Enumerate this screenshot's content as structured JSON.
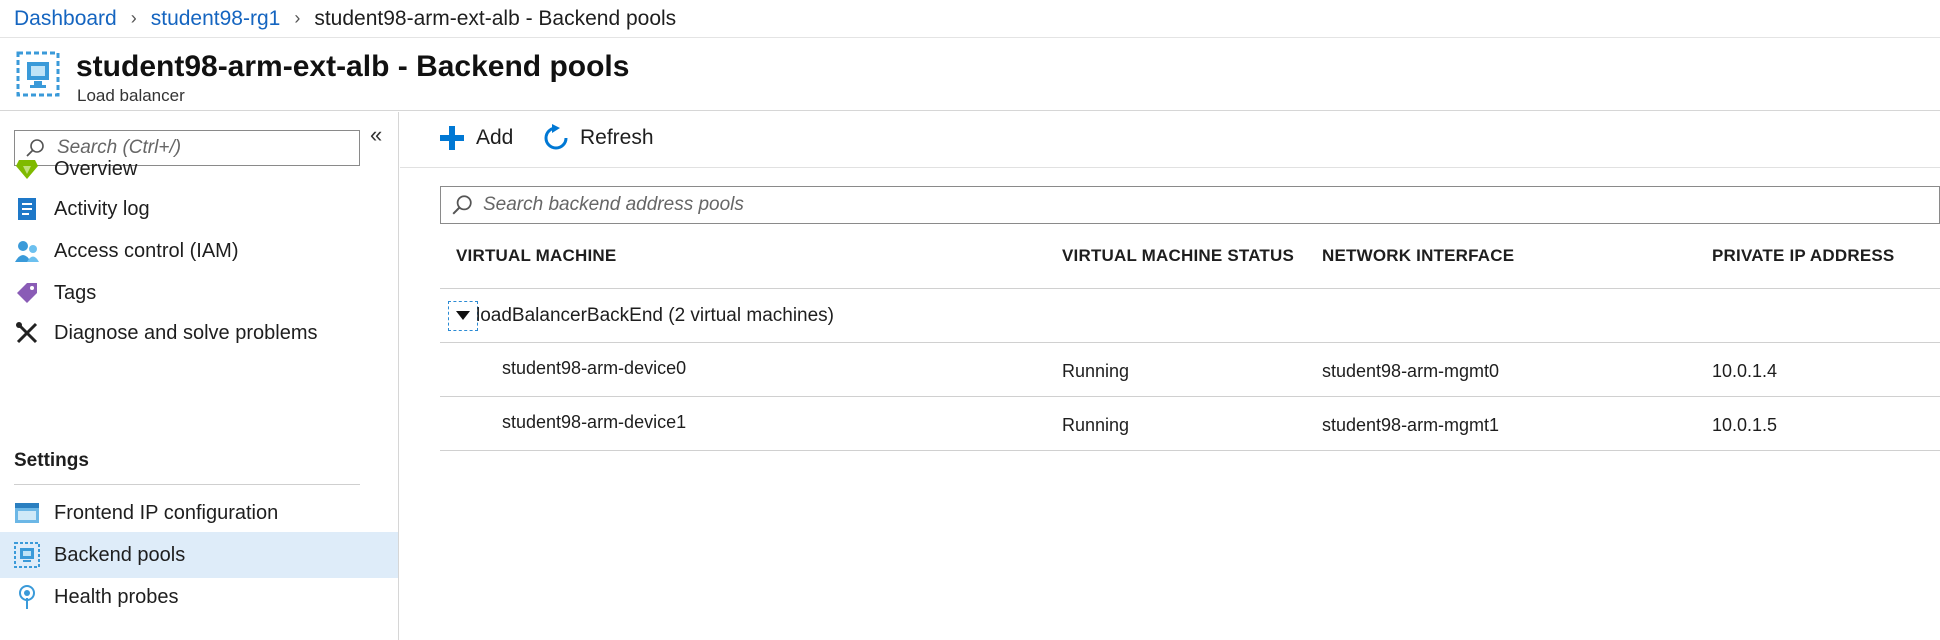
{
  "breadcrumb": {
    "items": [
      "Dashboard",
      "student98-rg1"
    ],
    "current": "student98-arm-ext-alb - Backend pools"
  },
  "header": {
    "title": "student98-arm-ext-alb - Backend pools",
    "subtitle": "Load balancer"
  },
  "sidebar": {
    "search_placeholder": "Search (Ctrl+/)",
    "items": [
      {
        "label": "Overview",
        "icon": "overview-icon"
      },
      {
        "label": "Activity log",
        "icon": "activity-log-icon"
      },
      {
        "label": "Access control (IAM)",
        "icon": "iam-icon"
      },
      {
        "label": "Tags",
        "icon": "tag-icon"
      },
      {
        "label": "Diagnose and solve problems",
        "icon": "wrench-icon"
      }
    ],
    "section_settings": "Settings",
    "settings_items": [
      {
        "label": "Frontend IP configuration",
        "icon": "frontend-ip-icon"
      },
      {
        "label": "Backend pools",
        "icon": "backend-pool-icon",
        "active": true
      },
      {
        "label": "Health probes",
        "icon": "health-probe-icon"
      }
    ]
  },
  "toolbar": {
    "add_label": "Add",
    "refresh_label": "Refresh"
  },
  "pool_search": {
    "placeholder": "Search backend address pools"
  },
  "table": {
    "columns": [
      "VIRTUAL MACHINE",
      "VIRTUAL MACHINE STATUS",
      "NETWORK INTERFACE",
      "PRIVATE IP ADDRESS"
    ],
    "group_label": "loadBalancerBackEnd (2 virtual machines)",
    "rows": [
      {
        "vm": "student98-arm-device0",
        "status": "Running",
        "nic": "student98-arm-mgmt0",
        "ip": "10.0.1.4"
      },
      {
        "vm": "student98-arm-device1",
        "status": "Running",
        "nic": "student98-arm-mgmt1",
        "ip": "10.0.1.5"
      }
    ]
  },
  "colors": {
    "link": "#1565c0",
    "accent": "#0078d4",
    "active_bg": "#deecf9"
  }
}
